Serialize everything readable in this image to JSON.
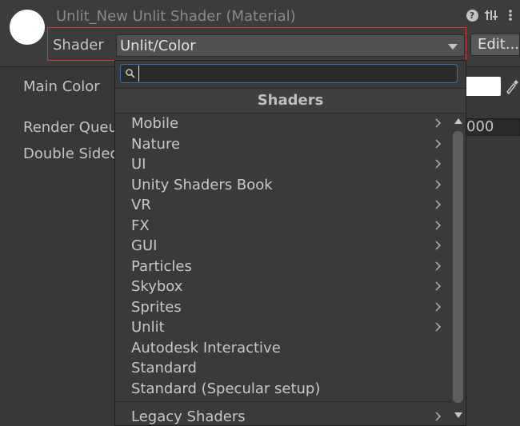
{
  "header": {
    "title": "Unlit_New Unlit Shader (Material)",
    "shader_label": "Shader",
    "shader_value": "Unlit/Color",
    "edit_button": "Edit..."
  },
  "properties": {
    "main_color": "Main Color",
    "render_queue": "Render Queu",
    "render_queue_value": "000",
    "double_sided": "Double Sidec"
  },
  "popup": {
    "search_value": "",
    "header": "Shaders",
    "items": [
      {
        "label": "Mobile",
        "submenu": true
      },
      {
        "label": "Nature",
        "submenu": true
      },
      {
        "label": "UI",
        "submenu": true
      },
      {
        "label": "Unity Shaders Book",
        "submenu": true
      },
      {
        "label": "VR",
        "submenu": true
      },
      {
        "label": "FX",
        "submenu": true
      },
      {
        "label": "GUI",
        "submenu": true
      },
      {
        "label": "Particles",
        "submenu": true
      },
      {
        "label": "Skybox",
        "submenu": true
      },
      {
        "label": "Sprites",
        "submenu": true
      },
      {
        "label": "Unlit",
        "submenu": true
      },
      {
        "label": "Autodesk Interactive",
        "submenu": false
      },
      {
        "label": "Standard",
        "submenu": false
      },
      {
        "label": "Standard (Specular setup)",
        "submenu": false
      }
    ],
    "legacy_label": "Legacy Shaders"
  },
  "colors": {
    "background": "#383838",
    "highlight_border": "#d43c3c",
    "search_focus": "#3f6fa8"
  },
  "icons": [
    "material-preview-icon",
    "help-icon",
    "settings-sliders-icon",
    "more-options-icon",
    "eyedropper-icon",
    "search-icon",
    "chevron-right-icon",
    "scroll-up-icon",
    "scroll-down-icon"
  ]
}
